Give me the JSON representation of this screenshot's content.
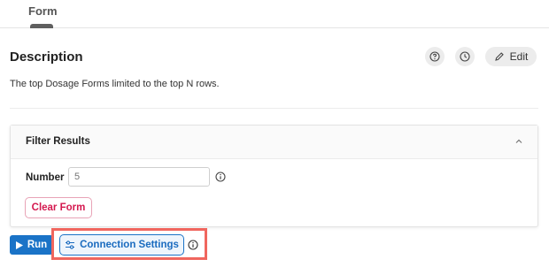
{
  "tabs": {
    "active_label": "Form"
  },
  "description": {
    "title": "Description",
    "text": "The top Dosage Forms limited to the top N rows.",
    "help_icon": "question-circle-icon",
    "history_icon": "clock-icon",
    "edit_icon": "pencil-icon",
    "edit_label": "Edit"
  },
  "filter": {
    "title": "Filter Results",
    "collapse_icon": "chevron-up-icon",
    "number_label": "Number",
    "number_placeholder": "5",
    "info_icon": "info-circle-icon",
    "clear_label": "Clear Form"
  },
  "actions": {
    "run_label": "Run",
    "run_icon": "play-icon",
    "connection_label": "Connection Settings",
    "connection_icon": "sliders-icon",
    "connection_info_icon": "info-circle-icon"
  },
  "colors": {
    "primary": "#1a73c7",
    "danger": "#d4194f",
    "highlight": "#f0665e"
  }
}
